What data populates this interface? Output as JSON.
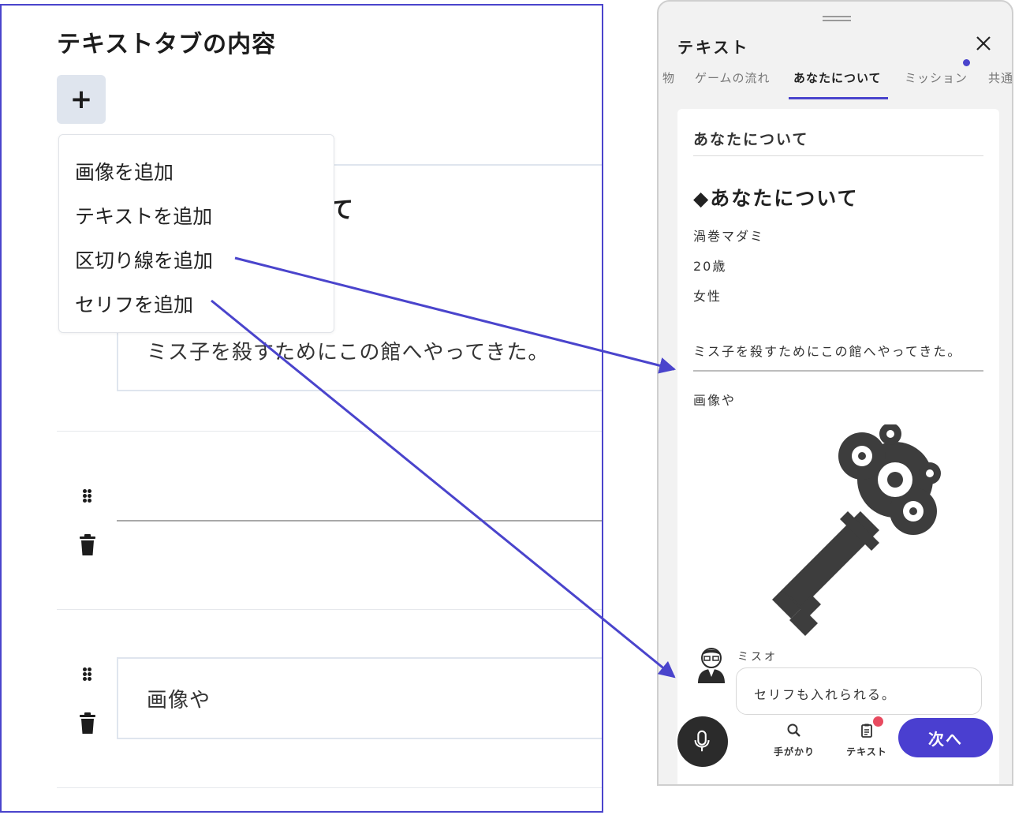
{
  "editor": {
    "title": "テキストタブの内容",
    "add_button_symbol": "+",
    "partial_heading": "て",
    "card1_text": "ミス子を殺すためにこの館へやってきた。",
    "card3_text": "画像や",
    "menu": [
      {
        "label": "画像を追加"
      },
      {
        "label": "テキストを追加"
      },
      {
        "label": "区切り線を追加"
      },
      {
        "label": "セリフを追加"
      }
    ]
  },
  "phone": {
    "title": "テキスト",
    "tabs": [
      {
        "label": "物"
      },
      {
        "label": "ゲームの流れ"
      },
      {
        "label": "あなたについて"
      },
      {
        "label": "ミッション"
      },
      {
        "label": "共通"
      }
    ],
    "active_tab": "あなたについて",
    "content": {
      "section_title": "あなたについて",
      "heading": "◆あなたについて",
      "lines": [
        "渦巻マダミ",
        "20歳",
        "女性"
      ],
      "sentence": "ミス子を殺すためにこの館へやってきた。",
      "image_caption": "画像や",
      "speaker": "ミスオ",
      "speech": "セリフも入れられる。"
    },
    "bottom_bar": {
      "hint_label": "手がかり",
      "text_label": "テキスト",
      "next_label": "次へ"
    }
  },
  "colors": {
    "accent": "#4a44cc",
    "next_button": "#4a3fd0",
    "notification": "#e84a5f"
  },
  "icons": [
    "plus-icon",
    "drag-handle-icon",
    "trash-icon",
    "close-icon",
    "mic-icon",
    "search-icon",
    "clipboard-icon",
    "key-image",
    "avatar-icon"
  ]
}
